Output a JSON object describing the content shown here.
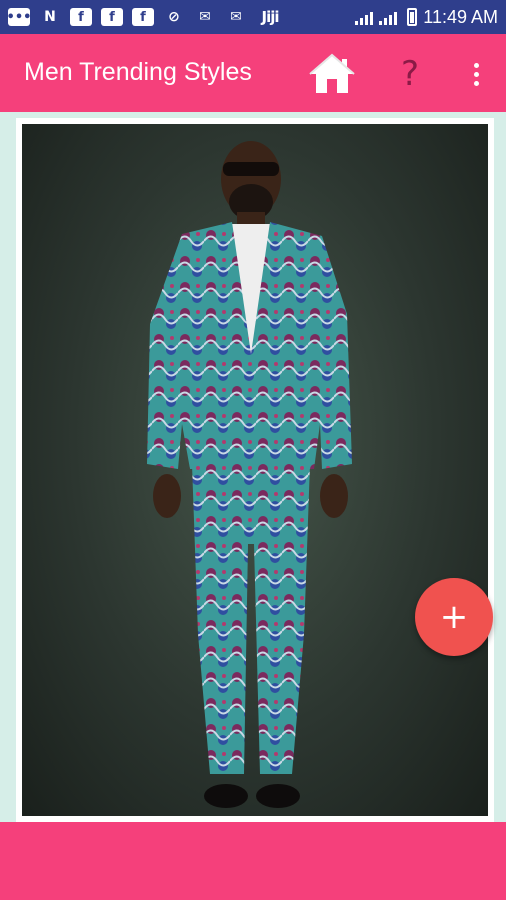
{
  "status_bar": {
    "icons": [
      "chat-bubble-icon",
      "n-icon",
      "facebook-icon",
      "facebook-icon",
      "facebook-icon",
      "compass-icon",
      "mail-icon",
      "mail-icon",
      "jiji-icon"
    ],
    "jiji_label": "Jiji",
    "time": "11:49 AM"
  },
  "app_bar": {
    "title": "Men Trending Styles",
    "help_label": "?",
    "background": "#f5407b"
  },
  "fab": {
    "label": "+",
    "color": "#f0524f"
  },
  "image": {
    "description_icon": "man-in-printed-suit-photo"
  }
}
